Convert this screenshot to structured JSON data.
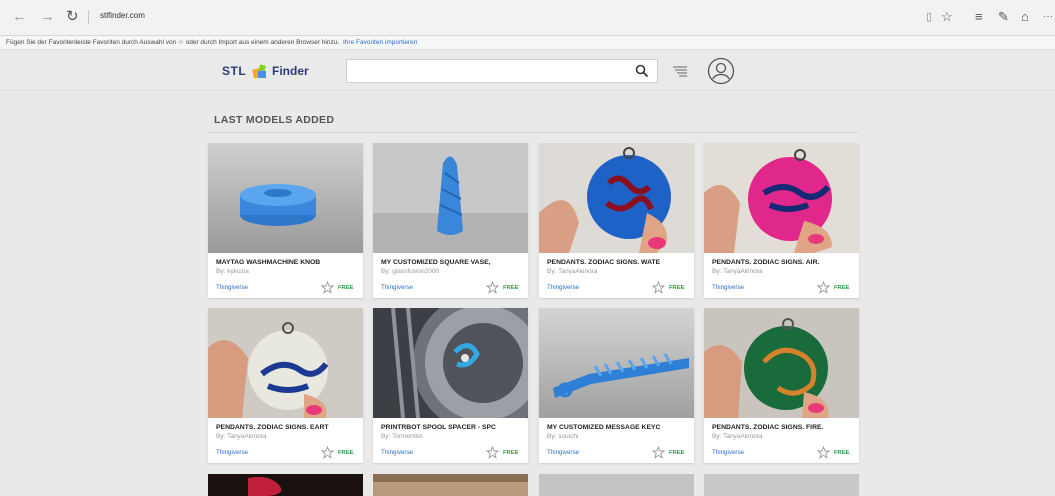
{
  "browser": {
    "url": "stlfinder.com",
    "nav": {
      "back": "←",
      "forward": "→",
      "refresh": "↻"
    },
    "toolbar_icons": [
      "reading-view-icon",
      "favorite-star-icon",
      "hub-icon",
      "web-note-icon",
      "share-icon",
      "more-icon"
    ]
  },
  "favorites_bar": {
    "text": "Fügen Sie der Favoritenleiste Favoriten durch Auswahl von ☆ oder durch Import aus einem anderen Browser hinzu.",
    "link": "Ihre Favoriten importieren"
  },
  "header": {
    "logo_left": "STL",
    "logo_right": "Finder",
    "search_placeholder": "",
    "search_value": ""
  },
  "main": {
    "section_title": "LAST MODELS ADDED",
    "cards": [
      {
        "name": "MAYTAG WASHMACHINE KNOB",
        "author": "By: kykozia",
        "source": "Thingiverse",
        "price": "FREE",
        "thumb": "blue-knob"
      },
      {
        "name": "MY CUSTOMIZED SQUARE VASE,",
        "author": "By: glassfusion2000",
        "source": "Thingiverse",
        "price": "FREE",
        "thumb": "blue-vase"
      },
      {
        "name": "PENDANTS. ZODIAC SIGNS. WATE",
        "author": "By: TanyaAkinora",
        "source": "Thingiverse",
        "price": "FREE",
        "thumb": "blue-pendant"
      },
      {
        "name": "PENDANTS. ZODIAC SIGNS. AIR.",
        "author": "By: TanyaAkinora",
        "source": "Thingiverse",
        "price": "FREE",
        "thumb": "pink-pendant"
      },
      {
        "name": "PENDANTS. ZODIAC SIGNS. EART",
        "author": "By: TanyaAkinora",
        "source": "Thingiverse",
        "price": "FREE",
        "thumb": "white-pendant"
      },
      {
        "name": "PRINTRBOT SPOOL SPACER - SPC",
        "author": "By: Tormentist",
        "source": "Thingiverse",
        "price": "FREE",
        "thumb": "spool"
      },
      {
        "name": "MY CUSTOMIZED MESSAGE KEYC",
        "author": "By: souichi",
        "source": "Thingiverse",
        "price": "FREE",
        "thumb": "keychain"
      },
      {
        "name": "PENDANTS. ZODIAC SIGNS. FIRE.",
        "author": "By: TanyaAkinora",
        "source": "Thingiverse",
        "price": "FREE",
        "thumb": "green-pendant"
      }
    ]
  },
  "colors": {
    "brand_navy": "#2c3e75",
    "link_blue": "#2a6fc9",
    "free_green": "#2f9e44"
  }
}
